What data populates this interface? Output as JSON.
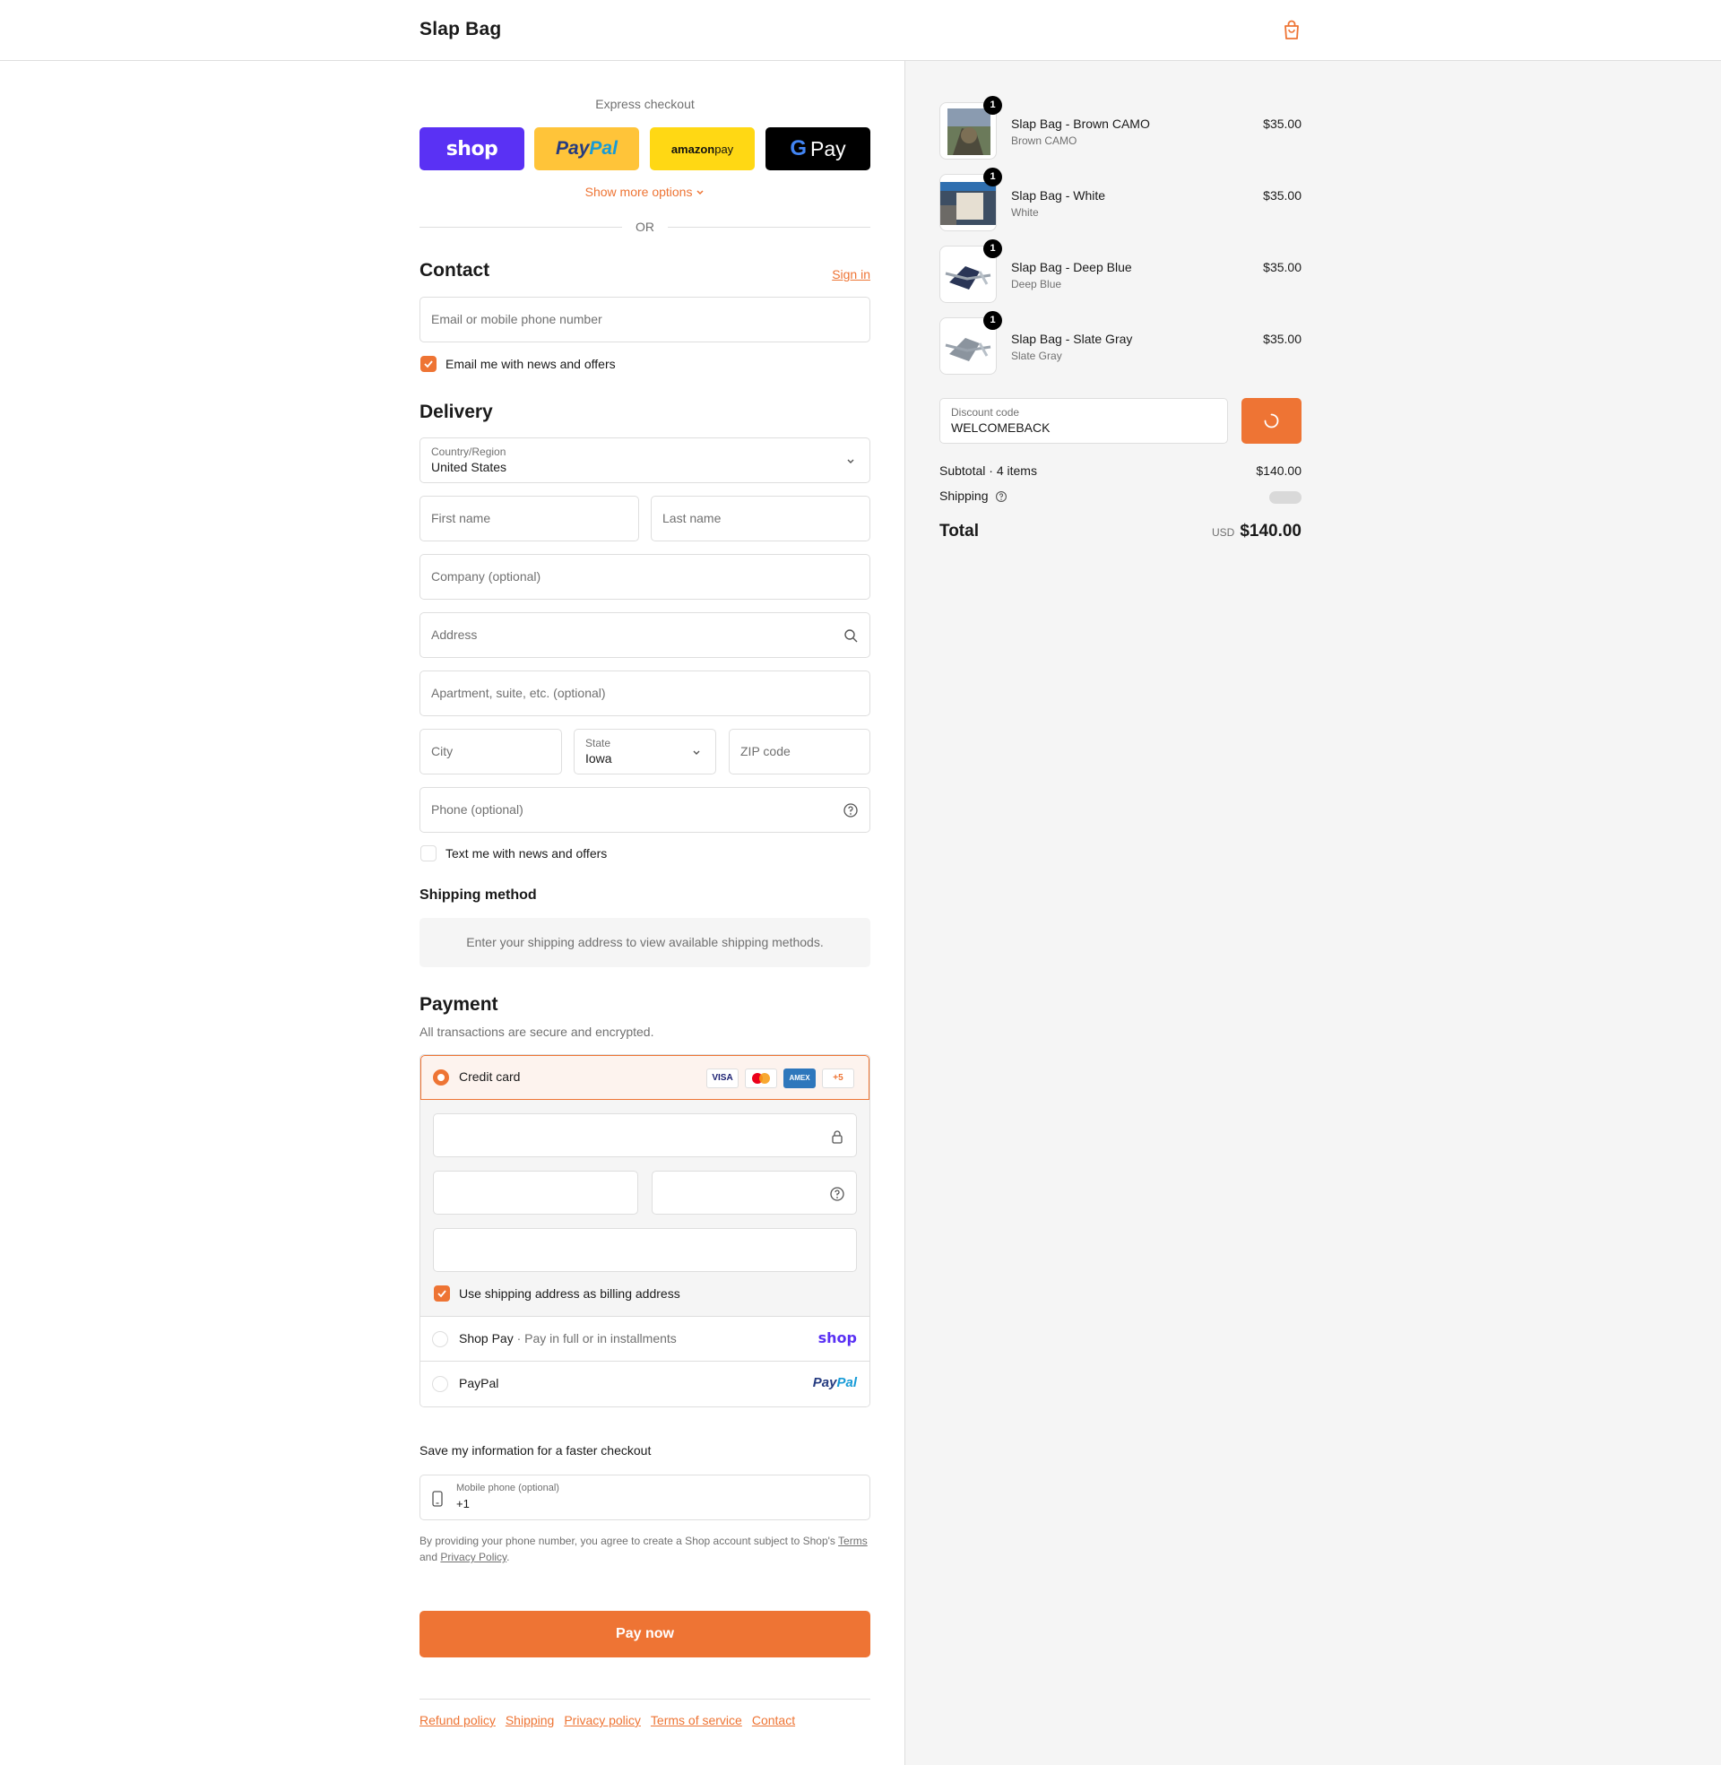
{
  "header": {
    "brand": "Slap Bag"
  },
  "express": {
    "title": "Express checkout",
    "shop": "shop",
    "paypal_a": "Pay",
    "paypal_b": "Pal",
    "amazon_a": "amazon",
    "amazon_b": " pay",
    "gpay_g": "G",
    "gpay_pay": "Pay",
    "more": "Show more options",
    "or": "OR"
  },
  "contact": {
    "heading": "Contact",
    "sign_in": "Sign in",
    "email_placeholder": "Email or mobile phone number",
    "news_label": "Email me with news and offers"
  },
  "delivery": {
    "heading": "Delivery",
    "country_label": "Country/Region",
    "country_value": "United States",
    "first_name": "First name",
    "last_name": "Last name",
    "company": "Company (optional)",
    "address": "Address",
    "apartment": "Apartment, suite, etc. (optional)",
    "city": "City",
    "state_label": "State",
    "state_value": "Iowa",
    "zip": "ZIP code",
    "phone": "Phone (optional)",
    "text_label": "Text me with news and offers"
  },
  "shipping_method": {
    "heading": "Shipping method",
    "note": "Enter your shipping address to view available shipping methods."
  },
  "payment": {
    "heading": "Payment",
    "subtitle": "All transactions are secure and encrypted.",
    "credit_card": "Credit card",
    "cards": [
      "VISA",
      "",
      "AMEX",
      "+5"
    ],
    "billing_label": "Use shipping address as billing address",
    "shop_pay": "Shop Pay",
    "shop_pay_sub": " · Pay in full or in installments",
    "shop_logo": "shop",
    "paypal": "PayPal",
    "paypal_logo_a": "Pay",
    "paypal_logo_b": "Pal"
  },
  "save_info": {
    "title": "Save my information for a faster checkout",
    "mobile_label": "Mobile phone (optional)",
    "mobile_value": "+1",
    "legal_a": "By providing your phone number, you agree to create a Shop account subject to Shop's ",
    "terms": "Terms",
    "legal_b": " and ",
    "privacy": "Privacy Policy",
    "legal_c": "."
  },
  "pay_now": "Pay now",
  "footer": [
    "Refund policy",
    "Shipping",
    "Privacy policy",
    "Terms of service",
    "Contact"
  ],
  "order": {
    "items": [
      {
        "name": "Slap Bag - Brown CAMO",
        "variant": "Brown CAMO",
        "qty": "1",
        "price": "$35.00"
      },
      {
        "name": "Slap Bag - White",
        "variant": "White",
        "qty": "1",
        "price": "$35.00"
      },
      {
        "name": "Slap Bag - Deep Blue",
        "variant": "Deep Blue",
        "qty": "1",
        "price": "$35.00"
      },
      {
        "name": "Slap Bag - Slate Gray",
        "variant": "Slate Gray",
        "qty": "1",
        "price": "$35.00"
      }
    ],
    "discount_label": "Discount code",
    "discount_value": "WELCOMEBACK",
    "subtotal_label": "Subtotal · 4 items",
    "subtotal_value": "$140.00",
    "shipping_label": "Shipping",
    "total_label": "Total",
    "currency": "USD",
    "total_value": "$140.00"
  },
  "colors": {
    "accent": "#ee7434",
    "shop_purple": "#5a31f4"
  }
}
